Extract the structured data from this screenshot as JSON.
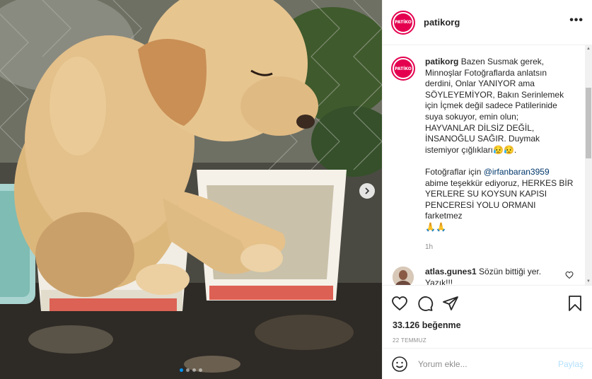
{
  "post": {
    "username": "patikorg",
    "avatar_text": "PATİKO",
    "caption_lines": [
      "Bazen Susmak gerek,",
      "Minnoşlar Fotoğraflarda anlatsın",
      "derdini, Onlar YANIYOR ama",
      "SÖYLEYEMİYOR, Bakın Serinlemek",
      "için İçmek değil sadece Patilerinide",
      "suya sokuyor, emin olun;",
      "HAYVANLAR DİLSİZ DEĞİL,",
      "İNSANOĞLU SAĞIR. Duymak",
      "istemiyor çığlıkları😥😥."
    ],
    "credit_prefix": "Fotoğraflar için ",
    "credit_mention": "@irfanbaran3959",
    "credit_lines": [
      "abime teşekkür ediyoruz, HERKES BİR",
      "YERLERE SU KOYSUN KAPISI",
      "PENCERESİ YOLU ORMANI farketmez",
      "🙏🙏"
    ],
    "time_ago": "1h",
    "likes": "33.126 beğenme",
    "date": "22 TEMMUZ",
    "slide_count": 4,
    "active_slide": 1
  },
  "comments": [
    {
      "username": "atlas.gunes1",
      "text_line1": "Sözün bittiği yer.",
      "text_line2": "Yazık!!!"
    }
  ],
  "add_comment": {
    "placeholder": "Yorum ekle...",
    "post_label": "Paylaş"
  },
  "icons": {
    "more": "more-options-icon",
    "next": "chevron-right-icon",
    "like": "heart-icon",
    "comment": "comment-bubble-icon",
    "share": "paper-plane-icon",
    "save": "bookmark-icon",
    "emoji": "smiley-icon"
  },
  "colors": {
    "brand": "#e4004f",
    "link": "#00376b",
    "post_button": "#b2dffc"
  }
}
